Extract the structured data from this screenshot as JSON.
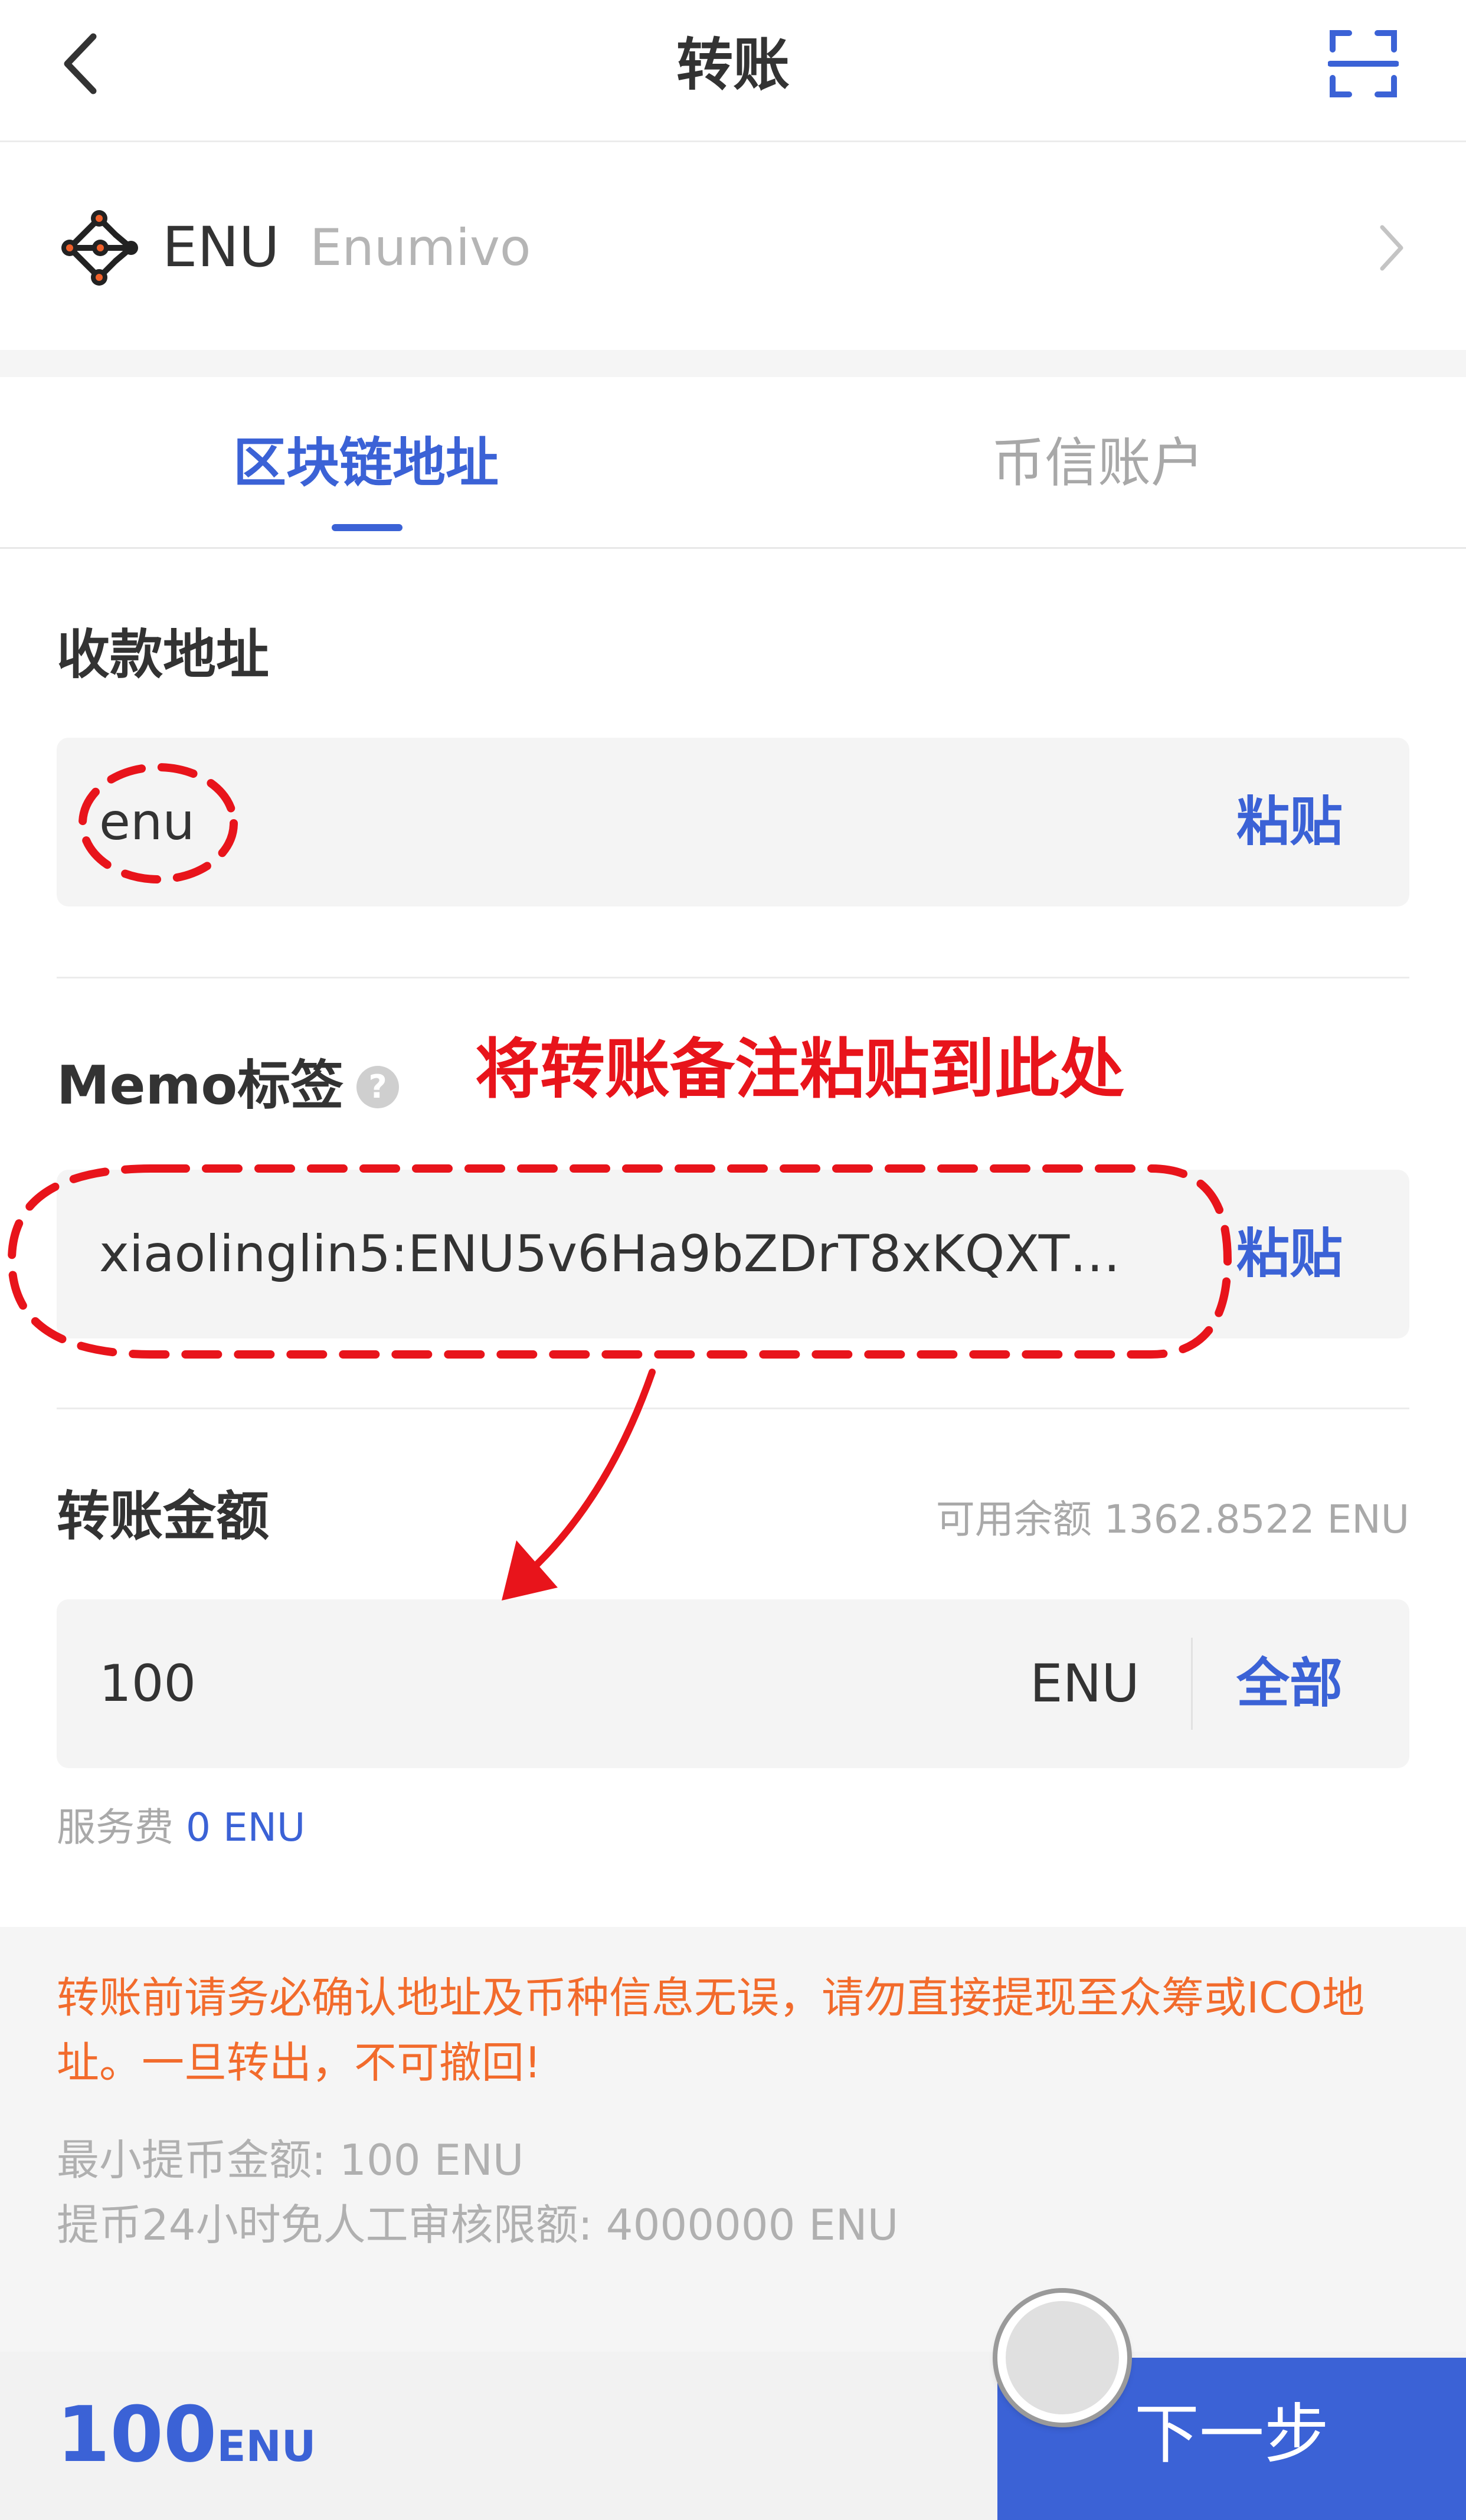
{
  "header": {
    "title": "转账",
    "back_icon": "chevron-left-icon",
    "scan_icon": "scan-icon"
  },
  "token": {
    "symbol": "ENU",
    "name": "Enumivo",
    "logo_icon": "enumivo-logo-icon"
  },
  "tabs": [
    {
      "label": "区块链地址",
      "active": true
    },
    {
      "label": "币信账户",
      "active": false
    }
  ],
  "address": {
    "label": "收款地址",
    "value": "enu",
    "paste_label": "粘贴"
  },
  "memo": {
    "label": "Memo标签",
    "help": "?",
    "value": "xiaolinglin5:ENU5v6Ha9bZDrT8xKQXT…",
    "paste_label": "粘贴"
  },
  "amount": {
    "label": "转账金额",
    "balance": "可用余额 1362.8522 ENU",
    "value": "100",
    "unit": "ENU",
    "all_label": "全部",
    "fee_label": "服务费",
    "fee_value": "0 ENU"
  },
  "notice": {
    "warning": "转账前请务必确认地址及币种信息无误，请勿直接提现至众筹或ICO地址。一旦转出，不可撤回!",
    "min_withdraw": "最小提币金额: 100 ENU",
    "limit_24h": "提币24小时免人工审核限额: 4000000 ENU"
  },
  "bottom": {
    "total_value": "100",
    "total_unit": "ENU",
    "next_label": "下一步"
  },
  "annotation": {
    "text": "将转账备注粘贴到此处",
    "color": "#e8141b"
  },
  "colors": {
    "accent": "#3b62d6",
    "warning": "#f26b2c",
    "annotation": "#e8141b"
  }
}
